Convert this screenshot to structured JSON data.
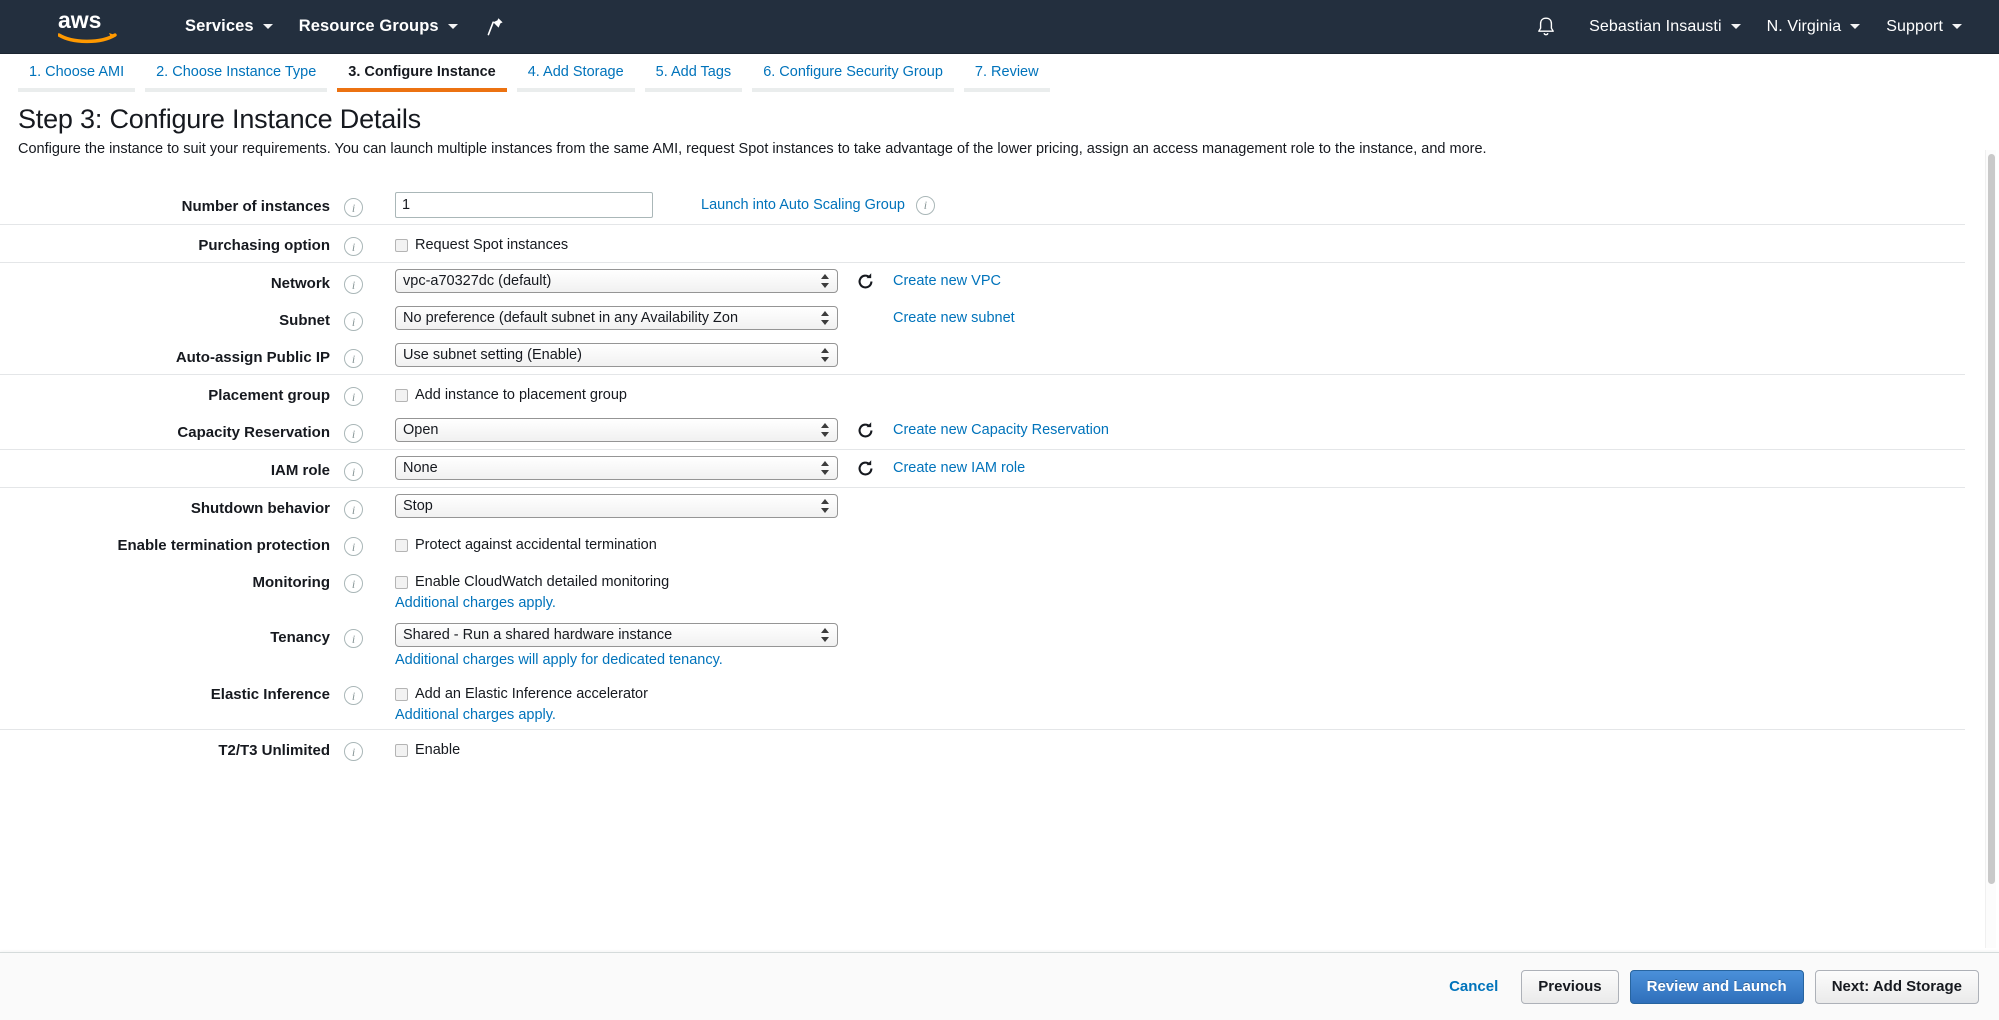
{
  "topnav": {
    "logo": "aws-logo",
    "left_items": [
      {
        "label": "Services",
        "caret": true
      },
      {
        "label": "Resource Groups",
        "caret": true
      }
    ],
    "pin_icon": "pin-icon",
    "bell_icon": "bell-icon",
    "right_items": [
      {
        "label": "Sebastian Insausti",
        "caret": true
      },
      {
        "label": "N. Virginia",
        "caret": true
      },
      {
        "label": "Support",
        "caret": true
      }
    ]
  },
  "wizard": {
    "tabs": [
      {
        "label": "1. Choose AMI",
        "active": false
      },
      {
        "label": "2. Choose Instance Type",
        "active": false
      },
      {
        "label": "3. Configure Instance",
        "active": true
      },
      {
        "label": "4. Add Storage",
        "active": false
      },
      {
        "label": "5. Add Tags",
        "active": false
      },
      {
        "label": "6. Configure Security Group",
        "active": false
      },
      {
        "label": "7. Review",
        "active": false
      }
    ],
    "active_underline_color": "#ec7211"
  },
  "page": {
    "title": "Step 3: Configure Instance Details",
    "description": "Configure the instance to suit your requirements. You can launch multiple instances from the same AMI, request Spot instances to take advantage of the lower pricing, assign an access management role to the instance, and more."
  },
  "form": {
    "number_of_instances": {
      "label": "Number of instances",
      "value": "1",
      "link": "Launch into Auto Scaling Group"
    },
    "purchasing_option": {
      "label": "Purchasing option",
      "checkbox_label": "Request Spot instances",
      "checked": false
    },
    "network": {
      "label": "Network",
      "value": "vpc-a70327dc (default)",
      "link": "Create new VPC"
    },
    "subnet": {
      "label": "Subnet",
      "value": "No preference (default subnet in any Availability Zon",
      "link": "Create new subnet"
    },
    "auto_assign_public_ip": {
      "label": "Auto-assign Public IP",
      "value": "Use subnet setting (Enable)"
    },
    "placement_group": {
      "label": "Placement group",
      "checkbox_label": "Add instance to placement group",
      "checked": false
    },
    "capacity_reservation": {
      "label": "Capacity Reservation",
      "value": "Open",
      "link": "Create new Capacity Reservation"
    },
    "iam_role": {
      "label": "IAM role",
      "value": "None",
      "link": "Create new IAM role"
    },
    "shutdown_behavior": {
      "label": "Shutdown behavior",
      "value": "Stop"
    },
    "termination_protection": {
      "label": "Enable termination protection",
      "checkbox_label": "Protect against accidental termination",
      "checked": false
    },
    "monitoring": {
      "label": "Monitoring",
      "checkbox_label": "Enable CloudWatch detailed monitoring",
      "checked": false,
      "sub_link": "Additional charges apply."
    },
    "tenancy": {
      "label": "Tenancy",
      "value": "Shared - Run a shared hardware instance",
      "sub_link": "Additional charges will apply for dedicated tenancy."
    },
    "elastic_inference": {
      "label": "Elastic Inference",
      "checkbox_label": "Add an Elastic Inference accelerator",
      "checked": false,
      "sub_link": "Additional charges apply."
    },
    "t2_t3_unlimited": {
      "label": "T2/T3 Unlimited",
      "checkbox_label": "Enable",
      "checked": false
    }
  },
  "footer": {
    "cancel": "Cancel",
    "previous": "Previous",
    "review_and_launch": "Review and Launch",
    "next": "Next: Add Storage",
    "primary_color": "#2f6fbb"
  }
}
